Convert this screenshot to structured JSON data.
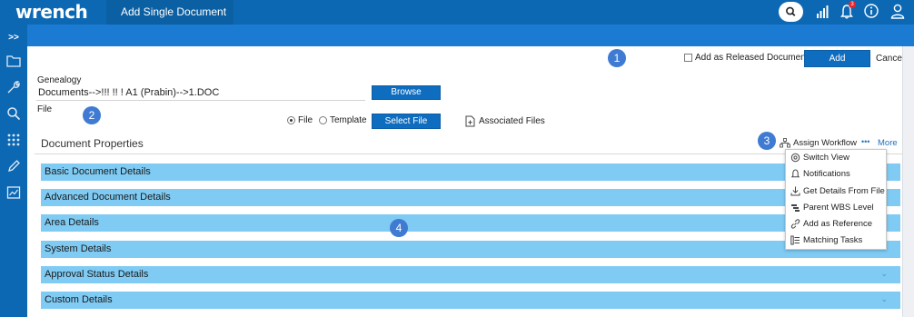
{
  "app": {
    "logo": "wrench",
    "tab_title": "Add Single Document",
    "notification_count": "3"
  },
  "rail": {
    "expand_label": ">>"
  },
  "markers": [
    "1",
    "2",
    "3",
    "4"
  ],
  "header_actions": {
    "released_checkbox_label": "Add as Released Document",
    "add_label": "Add",
    "cancel_label": "Cancel"
  },
  "genealogy": {
    "label": "Genealogy",
    "path": "Documents-->!!! !! ! A1 (Prabin)-->1.DOC",
    "browse_label": "Browse"
  },
  "file": {
    "label": "File",
    "option_file": "File",
    "option_template": "Template",
    "select_file_label": "Select File",
    "associated_files_label": "Associated Files"
  },
  "document_properties": {
    "title": "Document Properties",
    "assign_workflow_label": "Assign Workflow",
    "more_dots": "•••",
    "more_label": "More"
  },
  "sections": [
    "Basic Document Details",
    "Advanced Document Details",
    "Area Details",
    "System Details",
    "Approval Status Details",
    "Custom Details"
  ],
  "more_menu": [
    {
      "label": "Switch View",
      "icon": "switch-view-icon"
    },
    {
      "label": "Notifications",
      "icon": "bell-icon"
    },
    {
      "label": "Get Details From File",
      "icon": "download-icon"
    },
    {
      "label": "Parent WBS Level",
      "icon": "wbs-icon"
    },
    {
      "label": "Add as Reference",
      "icon": "link-icon"
    },
    {
      "label": "Matching Tasks",
      "icon": "task-list-icon"
    }
  ],
  "colors": {
    "brand_blue": "#0d68b3",
    "accordion": "#7fcbf4",
    "button": "#0f6dbf",
    "marker": "#3f7bd2"
  }
}
